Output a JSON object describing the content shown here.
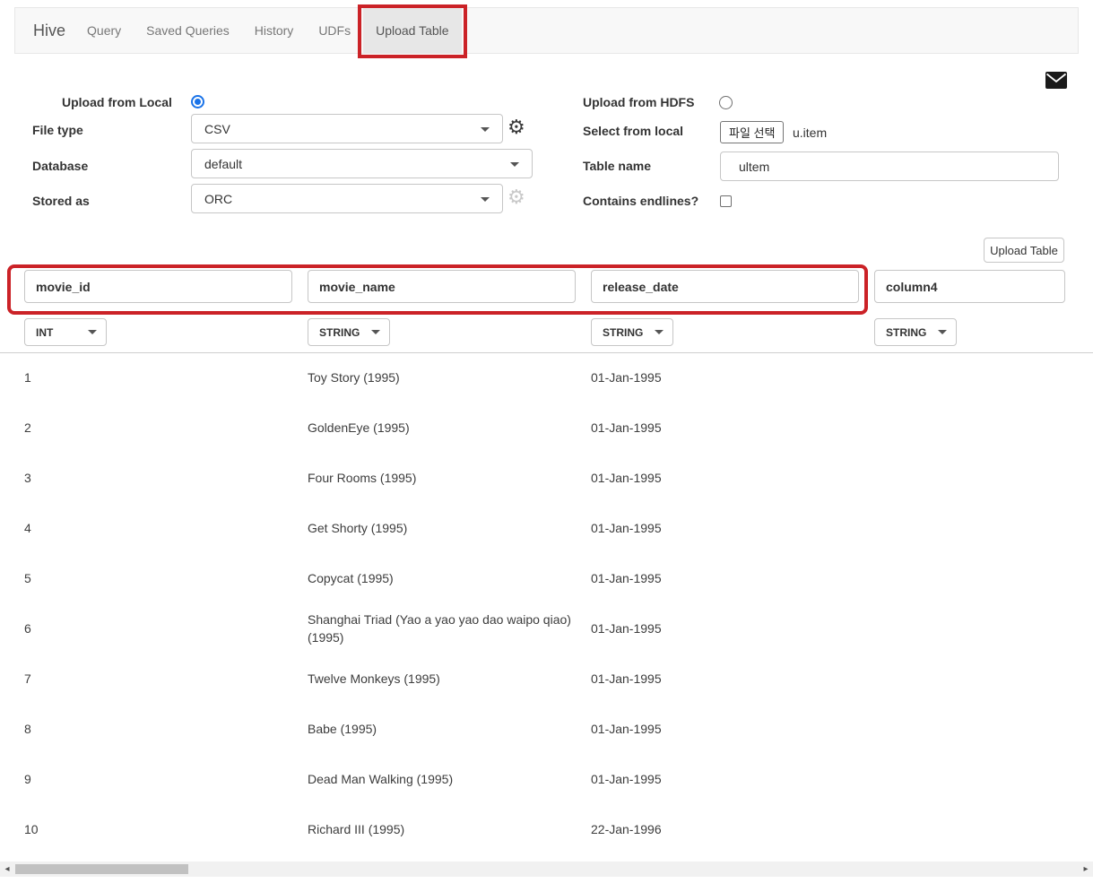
{
  "nav": {
    "brand": "Hive",
    "tabs": [
      {
        "label": "Query"
      },
      {
        "label": "Saved Queries"
      },
      {
        "label": "History"
      },
      {
        "label": "UDFs"
      },
      {
        "label": "Upload Table"
      }
    ],
    "active_tab": "Upload Table"
  },
  "form": {
    "upload_from_local": {
      "label": "Upload from Local",
      "selected": true
    },
    "upload_from_hdfs": {
      "label": "Upload from HDFS",
      "selected": false
    },
    "file_type": {
      "label": "File type",
      "value": "CSV"
    },
    "select_from_local": {
      "label": "Select from local",
      "button_label": "파일 선택",
      "file_name": "u.item"
    },
    "database": {
      "label": "Database",
      "value": "default"
    },
    "table_name": {
      "label": "Table name",
      "value": "ultem"
    },
    "stored_as": {
      "label": "Stored as",
      "value": "ORC"
    },
    "contains_endlines": {
      "label": "Contains endlines?",
      "checked": false
    }
  },
  "actions": {
    "upload_table_label": "Upload Table"
  },
  "table": {
    "columns": [
      {
        "name": "movie_id",
        "type": "INT"
      },
      {
        "name": "movie_name",
        "type": "STRING"
      },
      {
        "name": "release_date",
        "type": "STRING"
      },
      {
        "name": "column4",
        "type": "STRING"
      }
    ],
    "rows": [
      [
        "1",
        "Toy Story (1995)",
        "01-Jan-1995",
        ""
      ],
      [
        "2",
        "GoldenEye (1995)",
        "01-Jan-1995",
        ""
      ],
      [
        "3",
        "Four Rooms (1995)",
        "01-Jan-1995",
        ""
      ],
      [
        "4",
        "Get Shorty (1995)",
        "01-Jan-1995",
        ""
      ],
      [
        "5",
        "Copycat (1995)",
        "01-Jan-1995",
        ""
      ],
      [
        "6",
        "Shanghai Triad (Yao a yao yao dao waipo qiao) (1995)",
        "01-Jan-1995",
        ""
      ],
      [
        "7",
        "Twelve Monkeys (1995)",
        "01-Jan-1995",
        ""
      ],
      [
        "8",
        "Babe (1995)",
        "01-Jan-1995",
        ""
      ],
      [
        "9",
        "Dead Man Walking (1995)",
        "01-Jan-1995",
        ""
      ],
      [
        "10",
        "Richard III (1995)",
        "22-Jan-1996",
        ""
      ]
    ]
  },
  "icons": {
    "gear": "⚙",
    "scroll_left": "◂",
    "scroll_right": "▸"
  },
  "colors": {
    "annotation_red": "#cb2227",
    "radio_blue": "#1a73e8",
    "nav_bg": "#f8f8f8",
    "active_tab_bg": "#e7e7e7"
  }
}
